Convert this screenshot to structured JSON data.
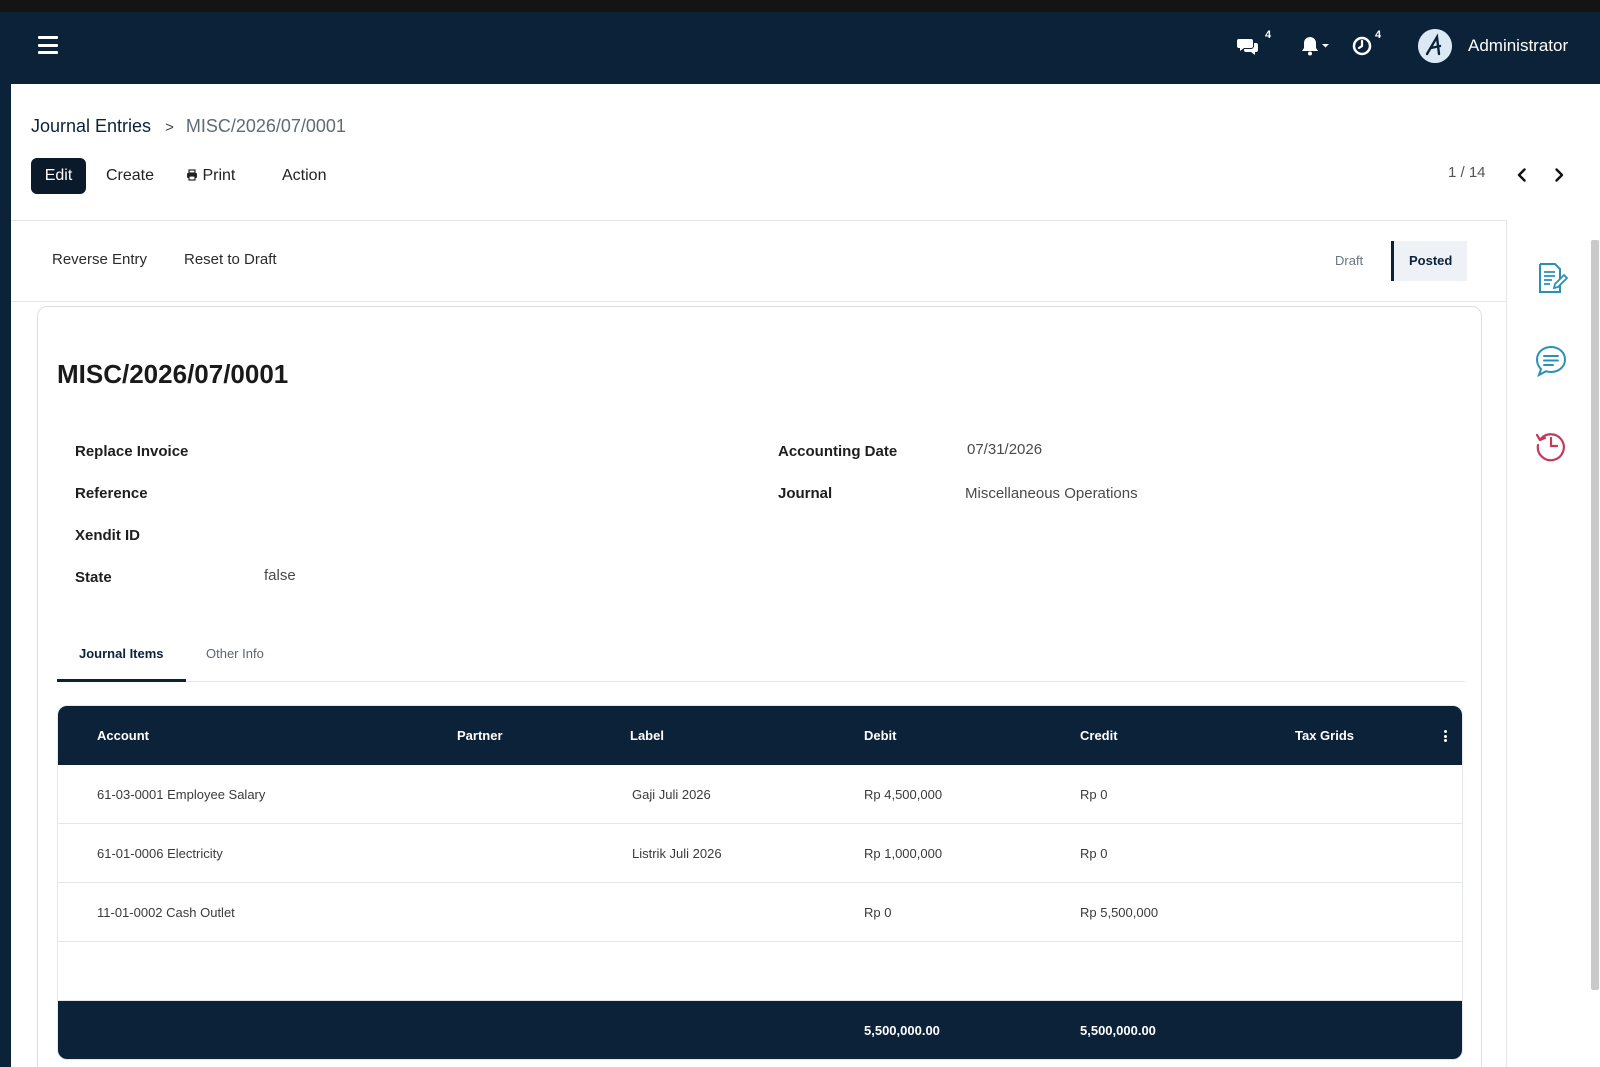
{
  "navbar": {
    "messages_count": "4",
    "activities_count": "4",
    "user_name": "Administrator",
    "icons": [
      "menu-icon",
      "chat-icon",
      "bell-icon",
      "clock-icon"
    ]
  },
  "breadcrumb": {
    "root": "Journal Entries",
    "separator": ">",
    "current": "MISC/2026/07/0001"
  },
  "toolbar": {
    "edit_label": "Edit",
    "create_label": "Create",
    "print_label": "Print",
    "action_label": "Action",
    "pager_text": "1 / 14"
  },
  "statusbar": {
    "reverse_label": "Reverse Entry",
    "reset_label": "Reset to Draft",
    "stages": [
      {
        "label": "Draft",
        "active": false
      },
      {
        "label": "Posted",
        "active": true
      }
    ]
  },
  "record": {
    "title": "MISC/2026/07/0001",
    "fields_left": [
      {
        "label": "Replace Invoice",
        "value": ""
      },
      {
        "label": "Reference",
        "value": ""
      },
      {
        "label": "Xendit ID",
        "value": ""
      },
      {
        "label": "State",
        "value": "false"
      }
    ],
    "fields_right": [
      {
        "label": "Accounting Date",
        "value": "07/31/2026"
      },
      {
        "label": "Journal",
        "value": "Miscellaneous Operations"
      }
    ]
  },
  "tabs": [
    {
      "label": "Journal Items",
      "active": true
    },
    {
      "label": "Other Info",
      "active": false
    }
  ],
  "table": {
    "headers": [
      "Account",
      "Partner",
      "Label",
      "Debit",
      "Credit",
      "Tax Grids"
    ],
    "rows": [
      [
        "61-03-0001 Employee Salary",
        "",
        "Gaji Juli 2026",
        "Rp 4,500,000",
        "Rp 0",
        ""
      ],
      [
        "61-01-0006 Electricity",
        "",
        "Listrik Juli 2026",
        "Rp 1,000,000",
        "Rp 0",
        ""
      ],
      [
        "11-01-0002 Cash Outlet",
        "",
        "",
        "Rp 0",
        "Rp 5,500,000",
        ""
      ]
    ],
    "totals": {
      "debit": "5,500,000.00",
      "credit": "5,500,000.00"
    }
  },
  "side_panel": {
    "icons": [
      "edit-note-icon",
      "message-icon",
      "history-icon"
    ]
  },
  "colors": {
    "navbar": "#0b2239",
    "accent_teal": "#2a91b6",
    "accent_red": "#c23b5a"
  }
}
